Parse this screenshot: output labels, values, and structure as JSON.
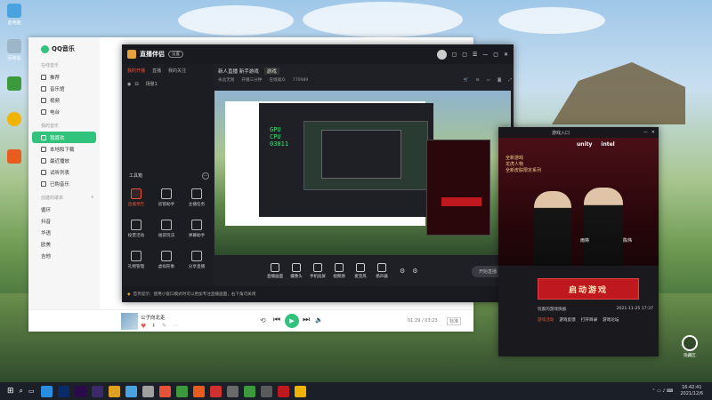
{
  "desktop": {
    "icons": [
      {
        "label": "此电脑",
        "color": "#4aa3df"
      },
      {
        "label": "回收站",
        "color": "#9fb6c8"
      },
      {
        "label": "",
        "color": "#3c9a3c"
      },
      {
        "label": "",
        "color": "#f0b400"
      },
      {
        "label": "",
        "color": "#e85d1f"
      }
    ]
  },
  "qqmusic": {
    "brand": "QQ音乐",
    "sections": {
      "online": "在线音乐",
      "mine": "我的音乐",
      "created": "创建的歌单",
      "add": "+"
    },
    "online_items": [
      "推荐",
      "音乐馆",
      "视频",
      "电台"
    ],
    "mine_items": [
      "我喜欢",
      "本地和下载",
      "最近播放",
      "试听列表",
      "已购音乐"
    ],
    "playlists": [
      "循环",
      "抖音",
      "华语",
      "欧美",
      "吉他"
    ],
    "active_item": "我喜欢",
    "player": {
      "song": "公子向北走",
      "time": "01:29 / 03:23",
      "quality": "标准"
    },
    "accent": "#31c27c"
  },
  "livestream": {
    "app_title": "直播伴侣",
    "badge": "设置",
    "tabs": [
      "我的开播",
      "直播",
      "我的关注"
    ],
    "stream_title": "新人直播 新手游戏",
    "category": "游戏",
    "meta": [
      "永远无限",
      "开播三分钟",
      "在线观众",
      "770989"
    ],
    "scene_label": "场景1",
    "tools_header": "工具箱",
    "tools": [
      {
        "label": "直播预告",
        "highlight": true
      },
      {
        "label": "房管助手",
        "highlight": false
      },
      {
        "label": "主播任务",
        "highlight": false
      },
      {
        "label": "投票活动",
        "highlight": false
      },
      {
        "label": "福袋玩法",
        "highlight": false
      },
      {
        "label": "弹幕助手",
        "highlight": false
      },
      {
        "label": "礼物管理",
        "highlight": false
      },
      {
        "label": "虚拟形象",
        "highlight": false
      },
      {
        "label": "分享直播",
        "highlight": false
      }
    ],
    "notice": "首页提示：使用小窗口模式时可以更加专注直播画面，右下角可关闭",
    "bottom_buttons": [
      "直播画面",
      "摄像头",
      "手机投屏",
      "视频源",
      "麦克风",
      "扬声器"
    ],
    "start_button": "开始直播",
    "preview_text": {
      "gpu": "GPU",
      "cpu": "CPU",
      "fps": "03011"
    },
    "accent": "#e8523a"
  },
  "game": {
    "title": "游戏入口",
    "brand_mid": "unity",
    "brand_right": "intel",
    "banner_line1": "全新游戏",
    "banner_line2": "龙虎人物",
    "banner_line3": "全新皮肤限定系列",
    "player1": "雨林",
    "player2": "陈伟",
    "start": "启动游戏",
    "news_title": "玩家的游戏快报",
    "news_date": "2021-11-25 17:37",
    "links": [
      "游戏活动",
      "游戏反馈",
      "打开目录",
      "游戏论坛"
    ]
  },
  "taskbar": {
    "time": "16:42:41",
    "date": "2021/12/6",
    "apps": [
      "#2a8ee0",
      "#0a2a6a",
      "#2a0a4a",
      "#3b2a6a",
      "#e0a020",
      "#4aa3df",
      "#a0a0a0",
      "#e8523a",
      "#3c9a3c",
      "#e85d1f",
      "#d03030",
      "#6a6a6a",
      "#3c9a3c",
      "#5a5a5a",
      "#c0181f",
      "#f0b400"
    ]
  },
  "overlay_icon": {
    "label": "隐藏区"
  }
}
